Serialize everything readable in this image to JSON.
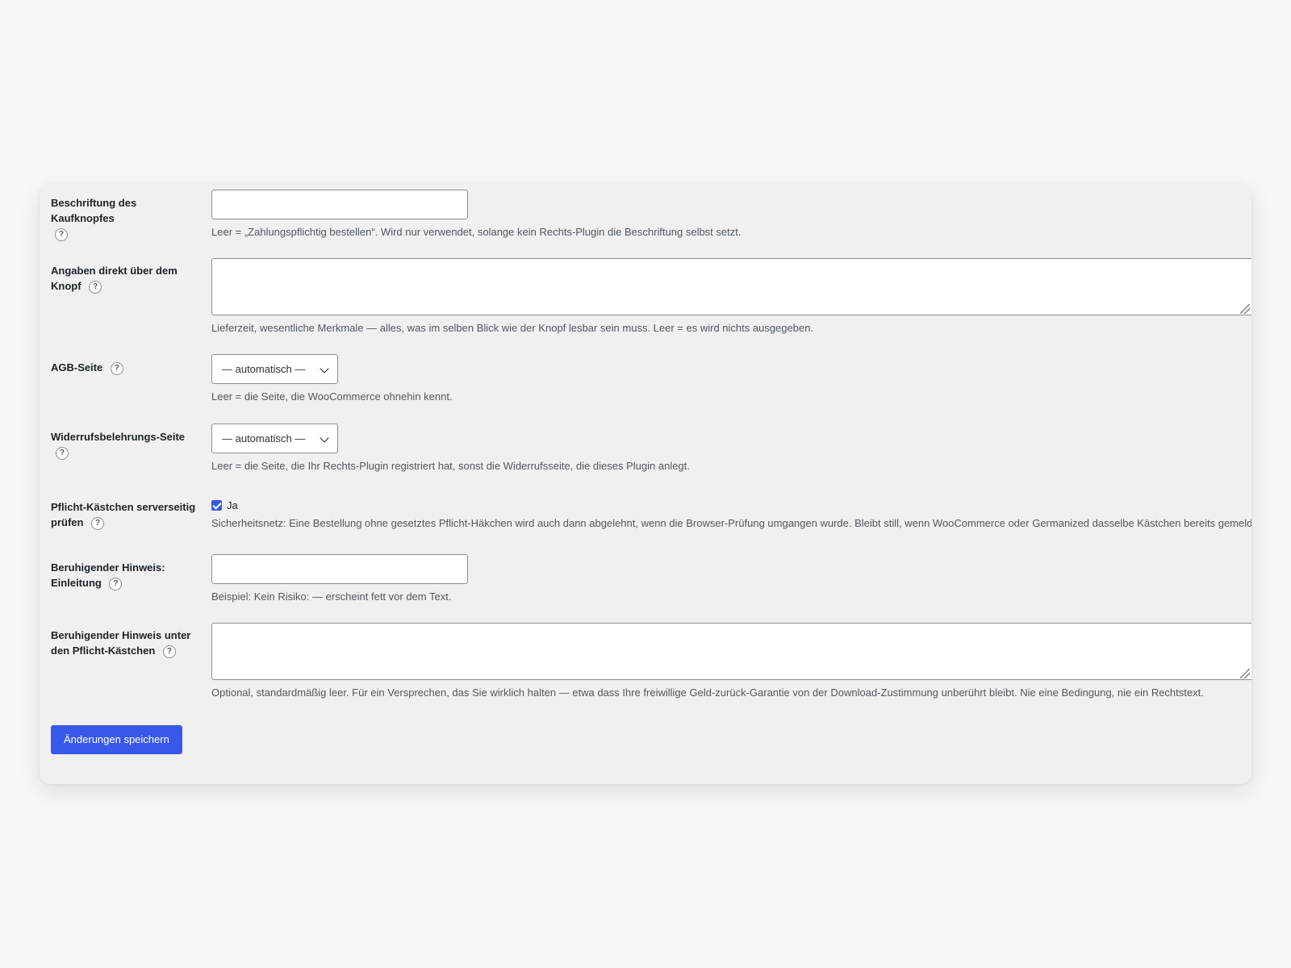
{
  "form": {
    "buy_button_label": {
      "label": "Beschriftung des Kaufknopfes",
      "value": "",
      "description": "Leer = „Zahlungspflichtig bestellen“. Wird nur verwendet, solange kein Rechts-Plugin die Beschriftung selbst setzt."
    },
    "above_button_info": {
      "label": "Angaben direkt über dem Knopf",
      "value": "",
      "description": "Lieferzeit, wesentliche Merkmale — alles, was im selben Blick wie der Knopf lesbar sein muss. Leer = es wird nichts ausgegeben."
    },
    "terms_page": {
      "label": "AGB-Seite",
      "selected": "— automatisch —",
      "description": "Leer = die Seite, die WooCommerce ohnehin kennt."
    },
    "withdrawal_page": {
      "label": "Widerrufsbelehrungs-Seite",
      "selected": "— automatisch —",
      "description": "Leer = die Seite, die Ihr Rechts-Plugin registriert hat, sonst die Widerrufsseite, die dieses Plugin anlegt."
    },
    "server_side_check": {
      "label": "Pflicht-Kästchen serverseitig prüfen",
      "checkbox_label": "Ja",
      "checked": true,
      "description": "Sicherheitsnetz: Eine Bestellung ohne gesetztes Pflicht-Häkchen wird auch dann abgelehnt, wenn die Browser-Prüfung umgangen wurde. Bleibt still, wenn WooCommerce oder Germanized dasselbe Kästchen bereits gemeldet hat."
    },
    "reassurance_intro": {
      "label": "Beruhigender Hinweis: Einleitung",
      "value": "",
      "description": "Beispiel: Kein Risiko: — erscheint fett vor dem Text."
    },
    "reassurance_text": {
      "label": "Beruhigender Hinweis unter den Pflicht-Kästchen",
      "value": "",
      "description": "Optional, standardmäßig leer. Für ein Versprechen, das Sie wirklich halten — etwa dass Ihre freiwillige Geld-zurück-Garantie von der Download-Zustimmung unberührt bleibt. Nie eine Bedingung, nie ein Rechtstext."
    },
    "help_glyph": "?",
    "save_label": "Änderungen speichern"
  },
  "colors": {
    "accent": "#3858e9",
    "panel_bg": "#f0f0f1",
    "page_bg": "#f6f7f9",
    "description_text": "#50575e"
  },
  "icons": {
    "help": "help-icon",
    "dropdown": "chevron-down-icon",
    "resize": "resize-grip-icon"
  }
}
